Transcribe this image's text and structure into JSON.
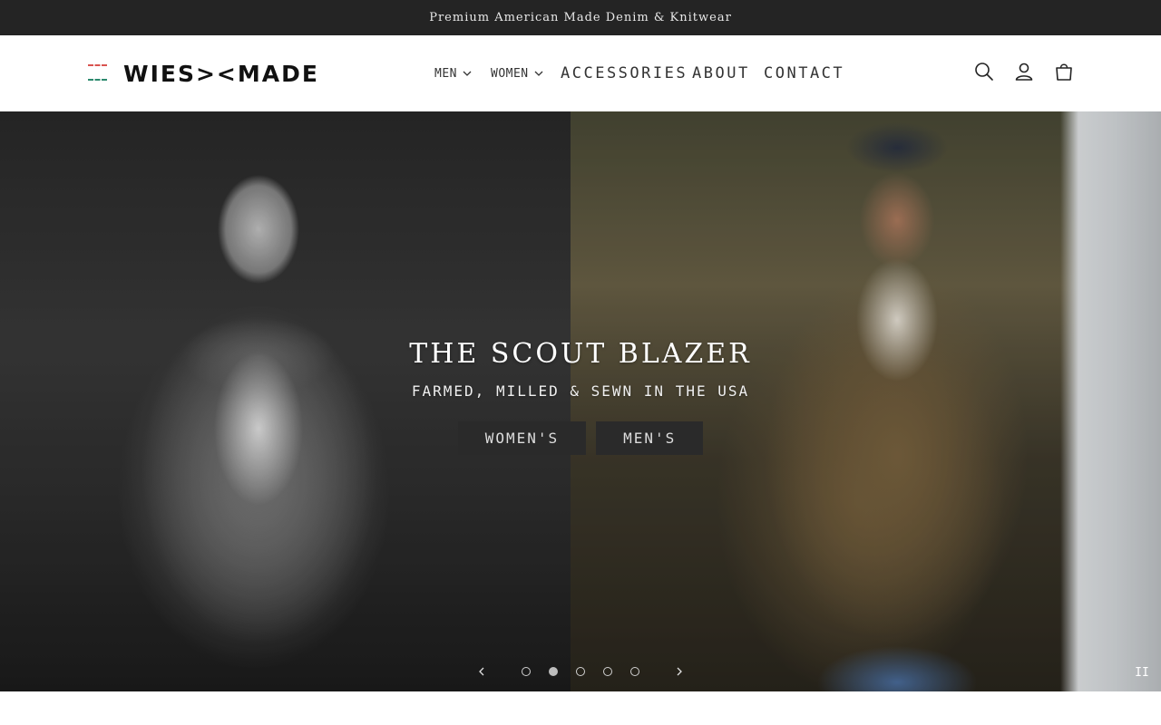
{
  "announcement": {
    "text": "Premium American Made Denim & Knitwear"
  },
  "header": {
    "logo_text": "WIES><MADE",
    "nav": [
      {
        "label": "MEN",
        "has_dropdown": true
      },
      {
        "label": "WOMEN",
        "has_dropdown": true
      },
      {
        "label": "ACCESSORIES",
        "has_dropdown": false
      },
      {
        "label": "ABOUT",
        "has_dropdown": false
      },
      {
        "label": "CONTACT",
        "has_dropdown": false
      }
    ],
    "icons": [
      "search-icon",
      "account-icon",
      "cart-icon"
    ]
  },
  "hero": {
    "title": "THE SCOUT BLAZER",
    "subtitle": "FARMED, MILLED & SEWN IN THE USA",
    "buttons": [
      {
        "label": "WOMEN'S"
      },
      {
        "label": "MEN'S"
      }
    ],
    "slides_total": 5,
    "active_slide": 2,
    "pause_label": "II"
  },
  "colors": {
    "announcement_bg": "#242424",
    "button_bg": "#2a2a2a",
    "logo_red": "#d9534f",
    "logo_green": "#2c8a6e"
  }
}
